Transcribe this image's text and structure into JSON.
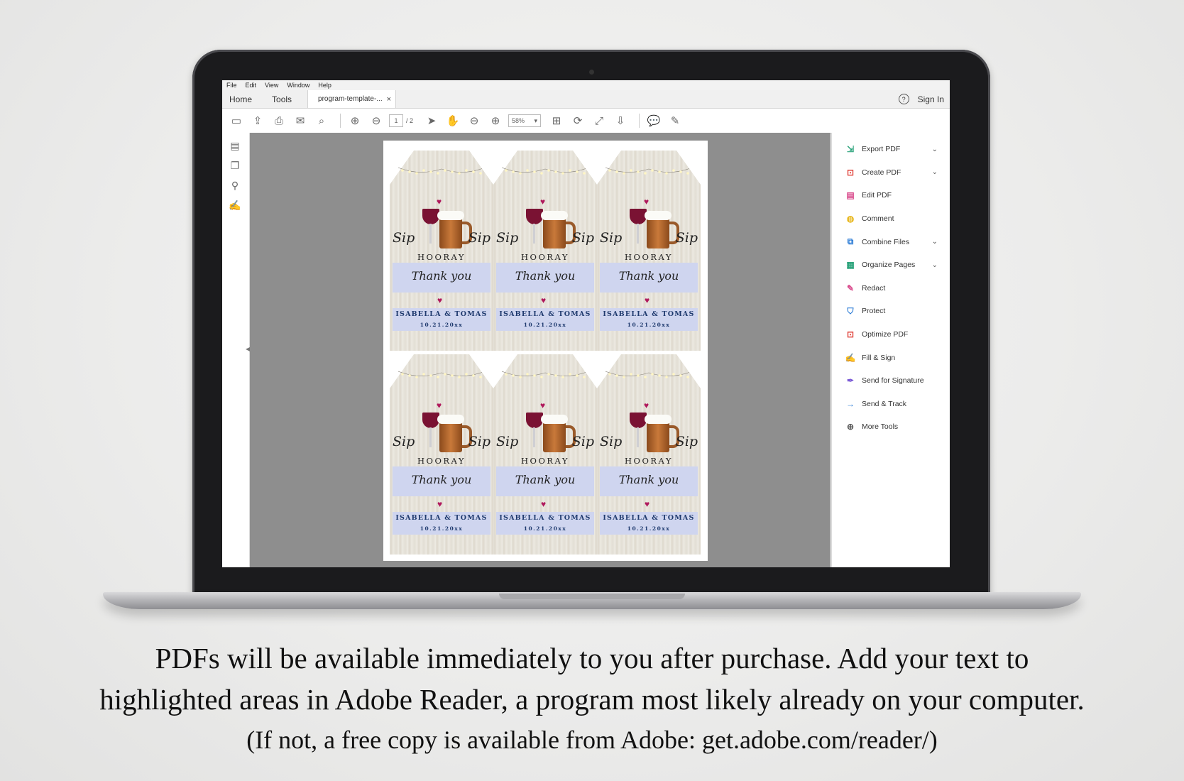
{
  "menubar": [
    "File",
    "Edit",
    "View",
    "Window",
    "Help"
  ],
  "tabbar": {
    "home": "Home",
    "tools": "Tools",
    "doc_tab": "program-template-...",
    "close": "×",
    "help": "?",
    "sign_in": "Sign In"
  },
  "toolbar": {
    "page_current": "1",
    "page_total": "/ 2",
    "zoom": "58%"
  },
  "right_panel": [
    {
      "label": "Export PDF",
      "icon": "export-pdf-icon",
      "color": "#2ba37b",
      "chevron": true
    },
    {
      "label": "Create PDF",
      "icon": "create-pdf-icon",
      "color": "#e0443c",
      "chevron": true
    },
    {
      "label": "Edit PDF",
      "icon": "edit-pdf-icon",
      "color": "#d94a8c",
      "chevron": false
    },
    {
      "label": "Comment",
      "icon": "comment-icon",
      "color": "#e8b820",
      "chevron": false
    },
    {
      "label": "Combine Files",
      "icon": "combine-files-icon",
      "color": "#2a7bd5",
      "chevron": true
    },
    {
      "label": "Organize Pages",
      "icon": "organize-pages-icon",
      "color": "#2ba37b",
      "chevron": true
    },
    {
      "label": "Redact",
      "icon": "redact-icon",
      "color": "#d94a8c",
      "chevron": false
    },
    {
      "label": "Protect",
      "icon": "protect-icon",
      "color": "#2a7bd5",
      "chevron": false
    },
    {
      "label": "Optimize PDF",
      "icon": "optimize-pdf-icon",
      "color": "#e0443c",
      "chevron": false
    },
    {
      "label": "Fill & Sign",
      "icon": "fill-sign-icon",
      "color": "#7b5bd6",
      "chevron": false
    },
    {
      "label": "Send for Signature",
      "icon": "send-for-signature-icon",
      "color": "#7b5bd6",
      "chevron": false
    },
    {
      "label": "Send & Track",
      "icon": "send-track-icon",
      "color": "#2a7bd5",
      "chevron": false
    },
    {
      "label": "More Tools",
      "icon": "more-tools-icon",
      "color": "#555555",
      "chevron": false
    }
  ],
  "tag": {
    "sip_left": "Sip",
    "sip_right": "Sip",
    "hooray": "HOORAY",
    "thanks": "Thank you",
    "names": "ISABELLA & TOMAS",
    "date": "10.21.20xx"
  },
  "caption": {
    "line1": "PDFs will be available immediately to you after purchase.  Add your text to",
    "line2": "highlighted areas in Adobe Reader, a program most likely already on your computer.",
    "line3": "(If not, a free copy is available from Adobe: get.adobe.com/reader/)"
  }
}
